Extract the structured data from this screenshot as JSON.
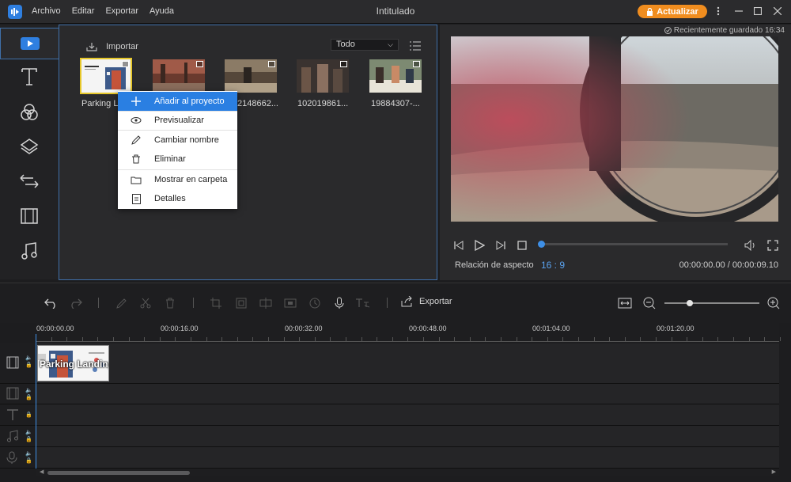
{
  "menu": [
    "Archivo",
    "Editar",
    "Exportar",
    "Ayuda"
  ],
  "window": {
    "title": "Intitulado",
    "upgrade_label": "Actualizar"
  },
  "nav": [
    "media-icon",
    "text-icon",
    "filters-icon",
    "overlays-icon",
    "transitions-icon",
    "elements-icon",
    "music-icon"
  ],
  "media": {
    "import_label": "Importar",
    "filter_value": "Todo",
    "items": [
      {
        "label": "Parking L"
      },
      {
        "label": ""
      },
      {
        "label": "2148662..."
      },
      {
        "label": "102019861..."
      },
      {
        "label": "19884307-..."
      }
    ]
  },
  "context_menu": {
    "items": [
      {
        "label": "Añadir al proyecto",
        "icon": "plus-icon"
      },
      {
        "label": "Previsualizar",
        "icon": "eye-icon"
      },
      {
        "label": "Cambiar nombre",
        "icon": "pencil-icon"
      },
      {
        "label": "Eliminar",
        "icon": "trash-icon"
      },
      {
        "label": "Mostrar en carpeta",
        "icon": "folder-icon"
      },
      {
        "label": "Detalles",
        "icon": "details-icon"
      }
    ]
  },
  "preview": {
    "saved_text": "Recientemente guardado 16:34",
    "aspect_label": "Relación de aspecto",
    "aspect_value": "16 : 9",
    "time_current": "00:00:00.00",
    "time_total": "00:00:09.10",
    "progress": 0.0
  },
  "toolbar": {
    "export_label": "Exportar",
    "zoom": 0.27
  },
  "timeline": {
    "ticks": [
      "00:00:00.00",
      "00:00:16.00",
      "00:00:32.00",
      "00:00:48.00",
      "00:01:04.00",
      "00:01:20.00"
    ],
    "clip_title": "Parking Landing"
  },
  "colors": {
    "accent": "#2a7fe2",
    "upgrade": "#f08d1f",
    "selection": "#e6c72a"
  }
}
